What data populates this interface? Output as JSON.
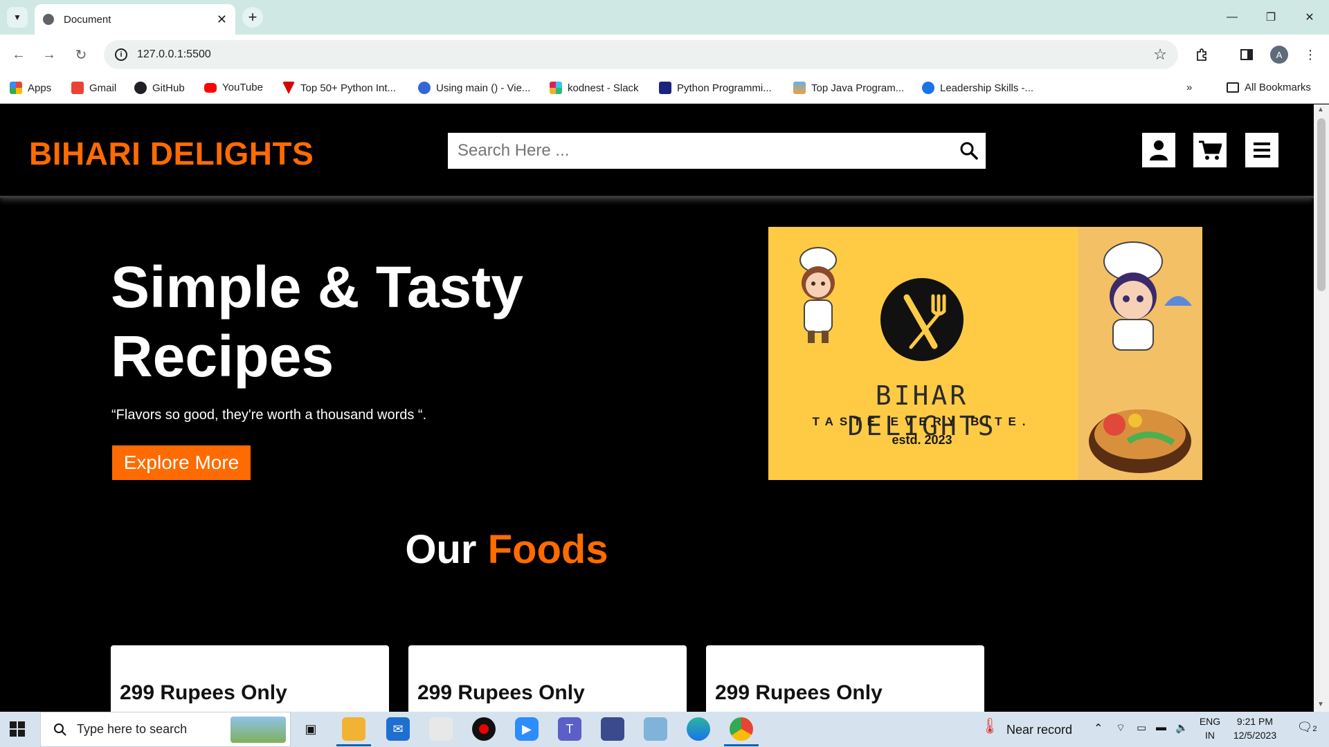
{
  "browser": {
    "tab_title": "Document",
    "new_tab": "+",
    "url": "127.0.0.1:5500",
    "profile_initial": "A",
    "bookmarks": [
      {
        "label": "Apps",
        "icon": "apps-grid-icon"
      },
      {
        "label": "Gmail",
        "icon": "gmail-icon"
      },
      {
        "label": "GitHub",
        "icon": "github-icon"
      },
      {
        "label": "YouTube",
        "icon": "youtube-icon"
      },
      {
        "label": "Top 50+ Python Int...",
        "icon": "bookmark-favicon"
      },
      {
        "label": "Using main () - Vie...",
        "icon": "bookmark-favicon"
      },
      {
        "label": "kodnest - Slack",
        "icon": "slack-icon"
      },
      {
        "label": "Python Programmi...",
        "icon": "bookmark-favicon"
      },
      {
        "label": "Top Java Program...",
        "icon": "bookmark-favicon"
      },
      {
        "label": "Leadership Skills -...",
        "icon": "bookmark-favicon"
      }
    ],
    "all_bookmarks": "All Bookmarks"
  },
  "site": {
    "logo": "BIHARI DELIGHTS",
    "search_placeholder": "Search Here ...",
    "hero": {
      "title": "Simple & Tasty Recipes",
      "quote": "“Flavors so good, they're worth a thousand words “.",
      "button": "Explore More"
    },
    "banner": {
      "brand": "BIHAR DELIGHTS",
      "tagline": "TASTE EVERY BITE.",
      "estd": "estd. 2023"
    },
    "section_title": {
      "prefix": "Our",
      "accent": "Foods"
    },
    "cards": [
      {
        "price": "299 Rupees Only"
      },
      {
        "price": "299 Rupees Only"
      },
      {
        "price": "299 Rupees Only"
      }
    ],
    "accent_color": "#ff6b00"
  },
  "taskbar": {
    "search_placeholder": "Type here to search",
    "weather": "Near record",
    "lang_top": "ENG",
    "lang_bottom": "IN",
    "time": "9:21 PM",
    "date": "12/5/2023",
    "notifications": "2"
  }
}
